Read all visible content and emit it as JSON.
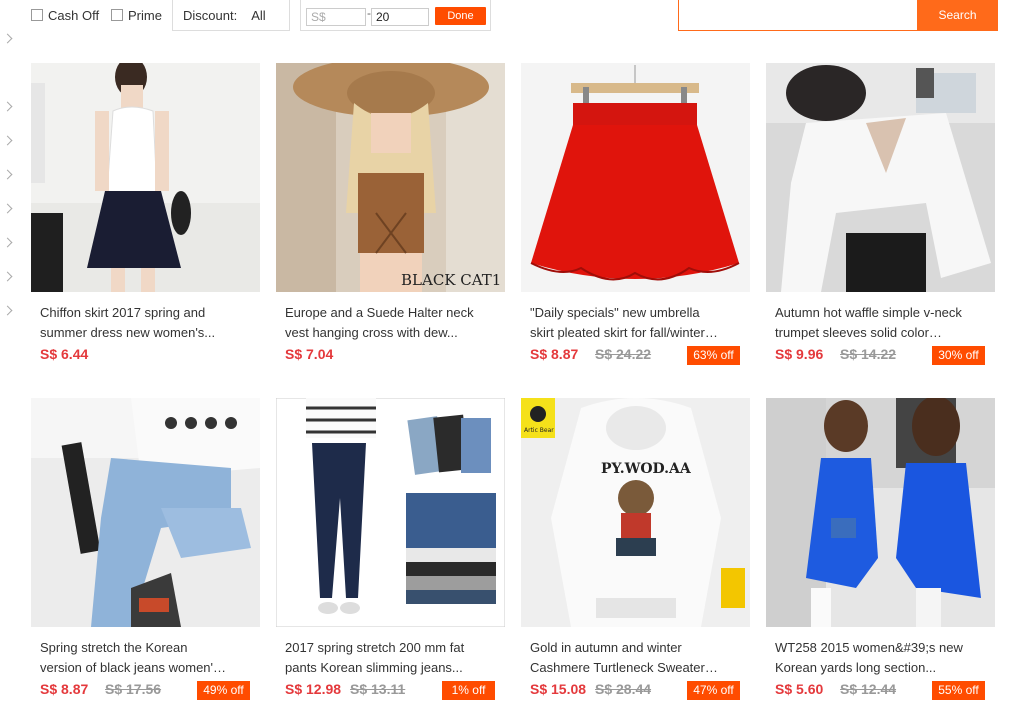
{
  "filters": {
    "cash_off_label": "Cash Off",
    "prime_label": "Prime",
    "discount_label": "Discount:",
    "discount_value": "All",
    "price_min_placeholder": "S$",
    "price_max_value": "20",
    "price_separator": "-",
    "done_label": "Done",
    "search_label": "Search"
  },
  "products": [
    {
      "title": "Chiffon skirt 2017 spring and summer dress new women's...",
      "price": "S$ 6.44",
      "old_price": "",
      "discount": ""
    },
    {
      "title": "Europe and a Suede Halter neck vest hanging cross with dew...",
      "price": "S$ 7.04",
      "old_price": "",
      "discount": ""
    },
    {
      "title": "\"Daily specials\" new umbrella skirt pleated skirt for fall/winter wild...",
      "price": "S$ 8.87",
      "old_price": "S$ 24.22",
      "discount": "63% off"
    },
    {
      "title": "Autumn hot waffle simple v-neck trumpet sleeves solid color long...",
      "price": "S$ 9.96",
      "old_price": "S$ 14.22",
      "discount": "30% off"
    },
    {
      "title": "Spring stretch the Korean version of black jeans women's nine...",
      "price": "S$ 8.87",
      "old_price": "S$ 17.56",
      "discount": "49% off"
    },
    {
      "title": "2017 spring stretch 200 mm fat pants Korean slimming jeans...",
      "price": "S$ 12.98",
      "old_price": "S$ 13.11",
      "discount": "1% off"
    },
    {
      "title": "Gold in autumn and winter Cashmere Turtleneck Sweater wit...",
      "price": "S$ 15.08",
      "old_price": "S$ 28.44",
      "discount": "47% off"
    },
    {
      "title": "WT258 2015 women&#39;s new Korean yards long section...",
      "price": "S$ 5.60",
      "old_price": "S$ 12.44",
      "discount": "55% off"
    }
  ],
  "image_texts": {
    "halter_watermark": "BLACK CAT1",
    "hoodie_print": "PY.WOD.AA",
    "hoodie_tag": "Artic Bear"
  },
  "colors": {
    "accent": "#ff4c00",
    "price": "#e4393c",
    "search": "#ff6a1a"
  }
}
